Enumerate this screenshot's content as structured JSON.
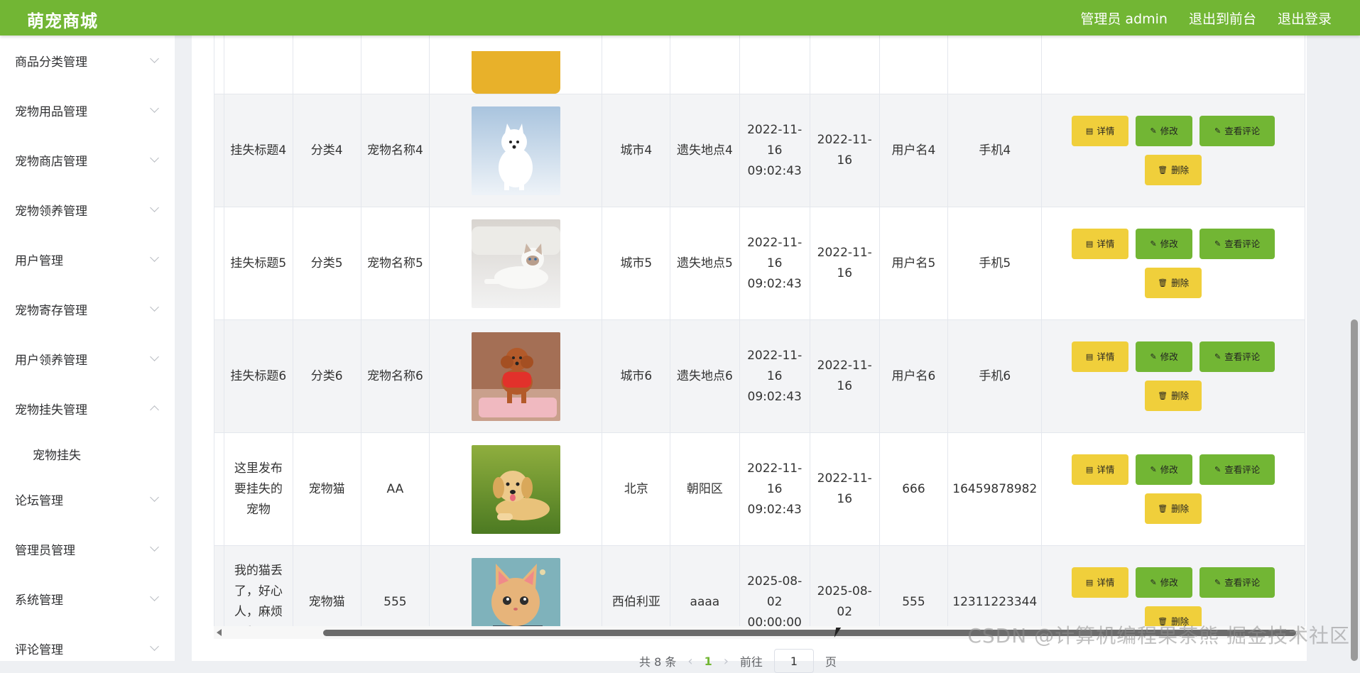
{
  "header": {
    "brand": "萌宠商城",
    "nav": [
      "管理员 admin",
      "退出到前台",
      "退出登录"
    ]
  },
  "sidebar": {
    "items": [
      {
        "label": "商品分类管理"
      },
      {
        "label": "宠物用品管理"
      },
      {
        "label": "宠物商店管理"
      },
      {
        "label": "宠物领养管理"
      },
      {
        "label": "用户管理"
      },
      {
        "label": "宠物寄存管理"
      },
      {
        "label": "用户领养管理"
      },
      {
        "label": "宠物挂失管理",
        "expanded": true
      },
      {
        "label": "论坛管理"
      },
      {
        "label": "管理员管理"
      },
      {
        "label": "系统管理"
      },
      {
        "label": "评论管理"
      }
    ],
    "sub_items": [
      "宠物挂失"
    ]
  },
  "table": {
    "actions": {
      "detail": "详情",
      "edit": "修改",
      "comments": "查看评论",
      "delete": "删除"
    },
    "rows": [
      {
        "title": "挂失标题4",
        "category": "分类4",
        "pet_name": "宠物名称4",
        "image": "white-samoyed-in-snow",
        "city": "城市4",
        "place": "遗失地点4",
        "published": "2022-11-16 09:02:43",
        "date": "2022-11-16",
        "user": "用户名4",
        "phone": "手机4"
      },
      {
        "title": "挂失标题5",
        "category": "分类5",
        "pet_name": "宠物名称5",
        "image": "white-cat-lying",
        "city": "城市5",
        "place": "遗失地点5",
        "published": "2022-11-16 09:02:43",
        "date": "2022-11-16",
        "user": "用户名5",
        "phone": "手机5"
      },
      {
        "title": "挂失标题6",
        "category": "分类6",
        "pet_name": "宠物名称6",
        "image": "brown-poodle",
        "city": "城市6",
        "place": "遗失地点6",
        "published": "2022-11-16 09:02:43",
        "date": "2022-11-16",
        "user": "用户名6",
        "phone": "手机6"
      },
      {
        "title": "这里发布要挂失的宠物",
        "category": "宠物猫",
        "pet_name": "AA",
        "image": "golden-puppy-on-grass",
        "city": "北京",
        "place": "朝阳区",
        "published": "2022-11-16 09:02:43",
        "date": "2022-11-16",
        "user": "666",
        "phone": "16459878982"
      },
      {
        "title": "我的猫丢了，好心人，麻烦看一下",
        "category": "宠物猫",
        "pet_name": "555",
        "image": "cute-kitten-toy",
        "city": "西伯利亚",
        "place": "aaaa",
        "published": "2025-08-02 00:00:00",
        "date": "2025-08-02",
        "user": "555",
        "phone": "12311223344"
      }
    ]
  },
  "pagination": {
    "total": "共 8 条",
    "current_page": "1",
    "goto_label": "前往",
    "goto_value": "1",
    "page_suffix": "页"
  },
  "watermark": "CSDN @计算机编程果茶熊  掘金技术社区",
  "colors": {
    "primary_green": "#72b634",
    "accent_yellow": "#f0cf3b"
  }
}
